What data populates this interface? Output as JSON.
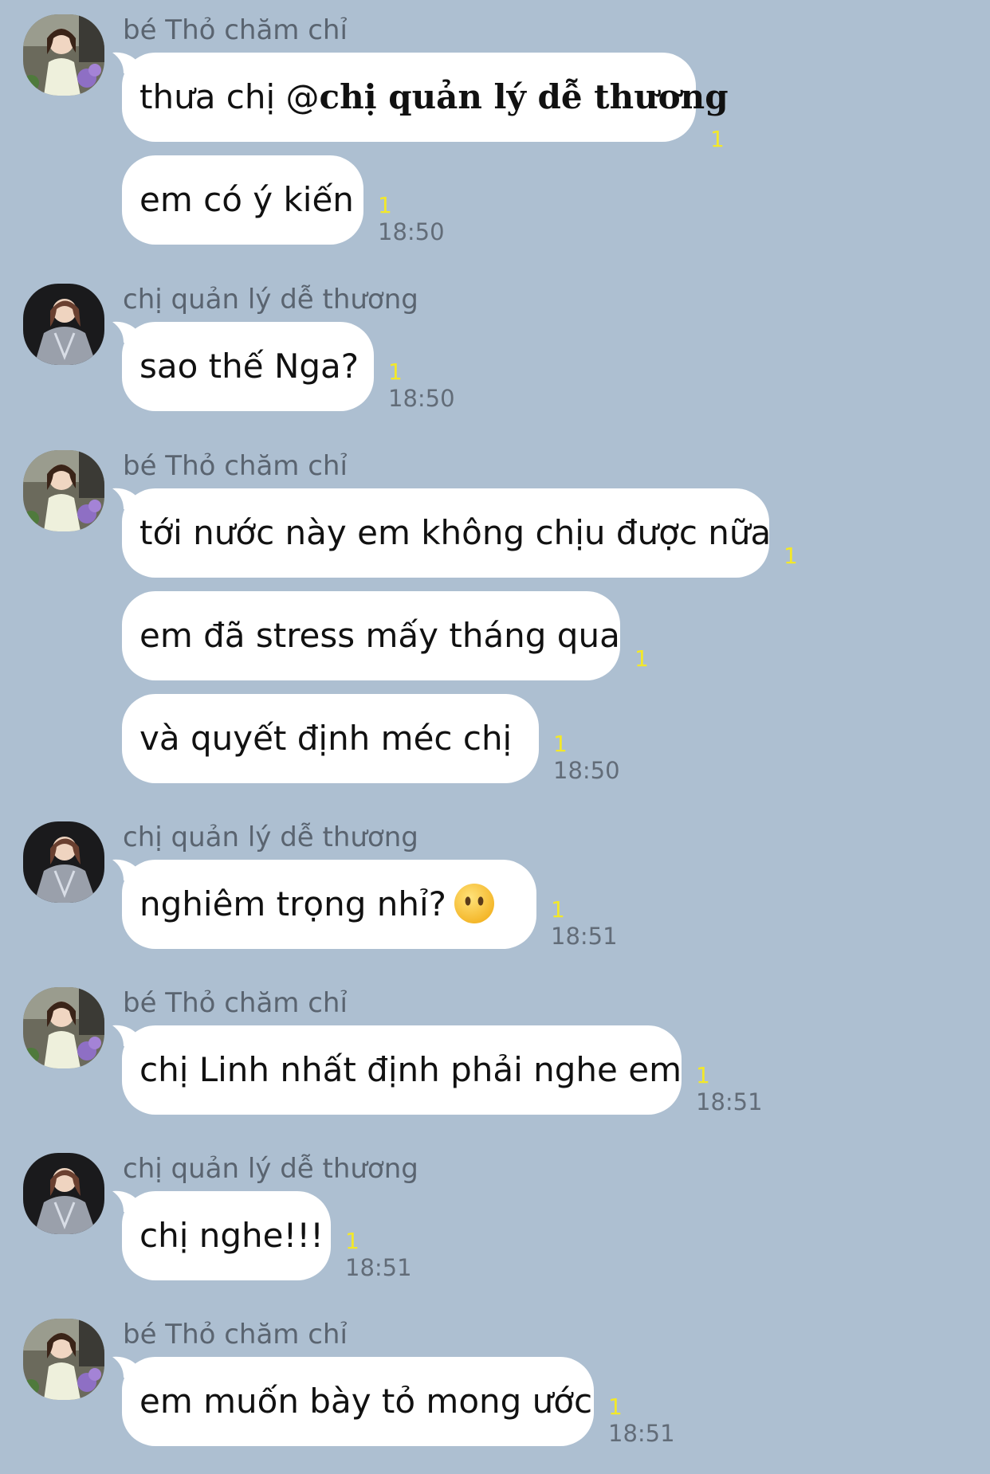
{
  "users": {
    "tho": {
      "name": "bé Thỏ chăm chỉ"
    },
    "manager": {
      "name": "chị quản lý dễ thương"
    }
  },
  "groups": [
    {
      "sender": "bé Thỏ chăm chỉ",
      "avatar": "tho",
      "messages": [
        {
          "prefix": "thưa chị @",
          "mention": "chị quản lý dễ thương",
          "read": "1",
          "time": ""
        },
        {
          "text": "em có ý kiến",
          "read": "1",
          "time": "18:50"
        }
      ]
    },
    {
      "sender": "chị quản lý dễ thương",
      "avatar": "manager",
      "messages": [
        {
          "text": "sao thế Nga?",
          "read": "1",
          "time": "18:50"
        }
      ]
    },
    {
      "sender": "bé Thỏ chăm chỉ",
      "avatar": "tho",
      "messages": [
        {
          "text": "tới nước này em không chịu được nữa",
          "read": "1",
          "time": ""
        },
        {
          "text": "em đã stress mấy tháng qua",
          "read": "1",
          "time": ""
        },
        {
          "text": "và quyết định méc chị",
          "read": "1",
          "time": "18:50"
        }
      ]
    },
    {
      "sender": "chị quản lý dễ thương",
      "avatar": "manager",
      "messages": [
        {
          "text": "nghiêm trọng nhỉ?",
          "emoji": "neutral-face-icon",
          "read": "1",
          "time": "18:51"
        }
      ]
    },
    {
      "sender": "bé Thỏ chăm chỉ",
      "avatar": "tho",
      "messages": [
        {
          "text": "chị Linh nhất định phải nghe em",
          "read": "1",
          "time": "18:51"
        }
      ]
    },
    {
      "sender": "chị quản lý dễ thương",
      "avatar": "manager",
      "messages": [
        {
          "text": "chị nghe!!!",
          "read": "1",
          "time": "18:51"
        }
      ]
    },
    {
      "sender": "bé Thỏ chăm chỉ",
      "avatar": "tho",
      "messages": [
        {
          "text": "em muốn bày tỏ mong ước",
          "read": "1",
          "time": "18:51"
        }
      ]
    }
  ],
  "colors": {
    "background": "#adbfd1",
    "bubble": "#ffffff",
    "read_indicator": "#f3e829",
    "timestamp": "#626c78",
    "sender_name": "#5a6470"
  }
}
